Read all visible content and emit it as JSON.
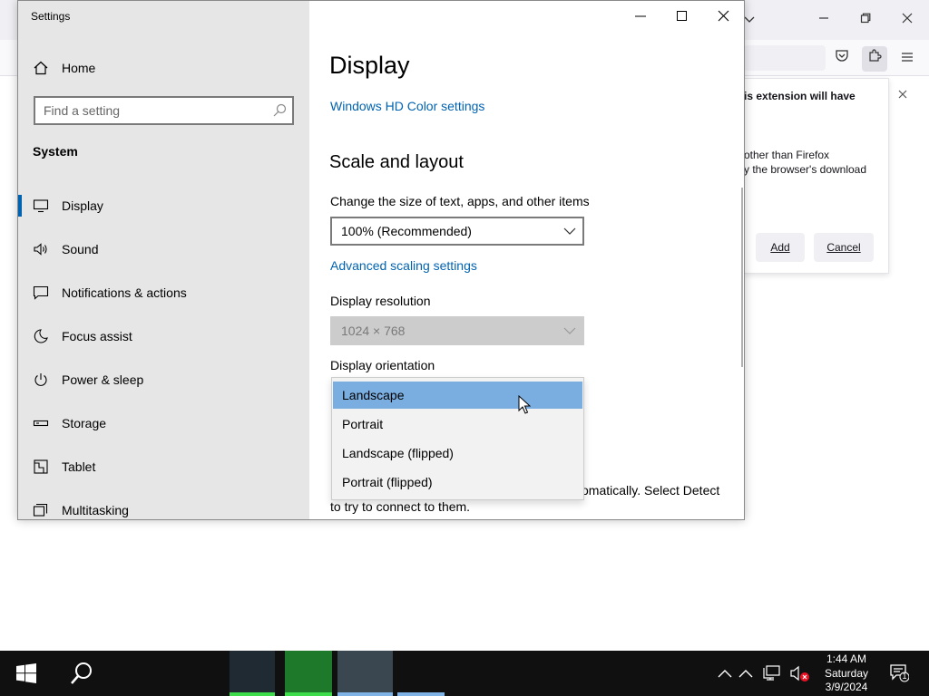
{
  "firefox": {
    "panel_title": "is extension will have",
    "panel_body": [
      "other than Firefox",
      "y the browser's download"
    ],
    "add_label": "Add",
    "cancel_label": "Cancel"
  },
  "settings": {
    "window_title": "Settings",
    "home_label": "Home",
    "search_placeholder": "Find a setting",
    "section_label": "System",
    "nav": [
      {
        "label": "Display",
        "icon": "monitor-icon",
        "active": true
      },
      {
        "label": "Sound",
        "icon": "speaker-icon"
      },
      {
        "label": "Notifications & actions",
        "icon": "message-icon"
      },
      {
        "label": "Focus assist",
        "icon": "moon-icon"
      },
      {
        "label": "Power & sleep",
        "icon": "power-icon"
      },
      {
        "label": "Storage",
        "icon": "storage-icon"
      },
      {
        "label": "Tablet",
        "icon": "tablet-icon"
      },
      {
        "label": "Multitasking",
        "icon": "multitasking-icon"
      }
    ],
    "main": {
      "page_title": "Display",
      "hd_color_link": "Windows HD Color settings",
      "scale_heading": "Scale and layout",
      "scale_label": "Change the size of text, apps, and other items",
      "scale_value": "100% (Recommended)",
      "advanced_scaling_link": "Advanced scaling settings",
      "resolution_label": "Display resolution",
      "resolution_value": "1024 × 768",
      "orientation_label": "Display orientation",
      "orientation_options": [
        "Landscape",
        "Portrait",
        "Landscape (flipped)",
        "Portrait (flipped)"
      ],
      "orientation_selected": "Landscape",
      "detect_text_1": "omatically. Select Detect",
      "detect_text_2": "to try to connect to them."
    }
  },
  "taskbar": {
    "time": "1:44 AM",
    "day": "Saturday",
    "date": "3/9/2024",
    "notification_count": "1"
  },
  "colors": {
    "accent": "#0063b1",
    "selection": "#7aaee0",
    "sidebar_bg": "#e6e6e6",
    "taskbar_bg": "#101010"
  }
}
